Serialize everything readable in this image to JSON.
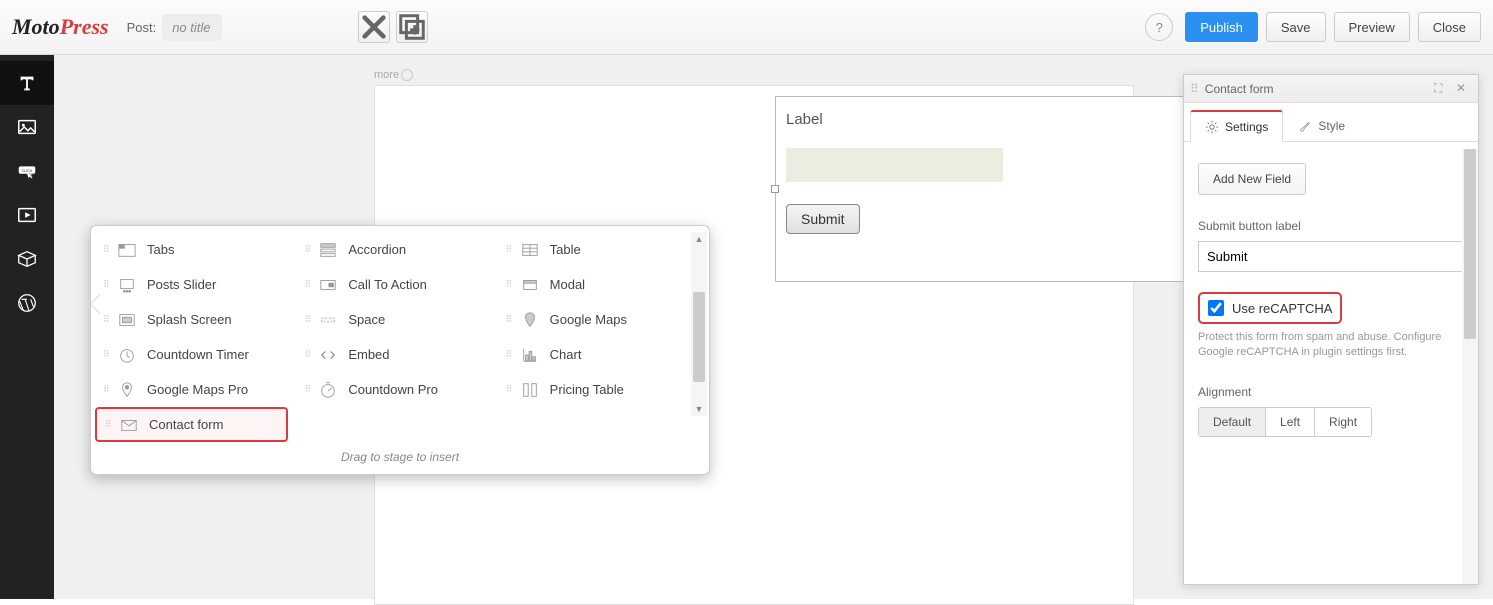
{
  "header": {
    "logo1": "Moto",
    "logo2": "Press",
    "post_label": "Post:",
    "post_title": "no title",
    "help": "?",
    "publish": "Publish",
    "save": "Save",
    "preview": "Preview",
    "close": "Close"
  },
  "more_tag": "more",
  "flyout": {
    "hint": "Drag to stage to insert",
    "col1": [
      "Tabs",
      "Posts Slider",
      "Splash Screen",
      "Countdown Timer",
      "Google Maps Pro",
      "Contact form"
    ],
    "col2": [
      "Accordion",
      "Call To Action",
      "Space",
      "Embed",
      "Countdown Pro"
    ],
    "col3": [
      "Table",
      "Modal",
      "Google Maps",
      "Chart",
      "Pricing Table"
    ]
  },
  "form_preview": {
    "label": "Label",
    "submit": "Submit"
  },
  "panel": {
    "title": "Contact form",
    "tab_settings": "Settings",
    "tab_style": "Style",
    "add_field": "Add New Field",
    "submit_label_caption": "Submit button label",
    "submit_label_value": "Submit",
    "recaptcha_label": "Use reCAPTCHA",
    "recaptcha_help": "Protect this form from spam and abuse. Configure Google reCAPTCHA in plugin settings first.",
    "alignment_caption": "Alignment",
    "alignment_opts": [
      "Default",
      "Left",
      "Right"
    ]
  }
}
